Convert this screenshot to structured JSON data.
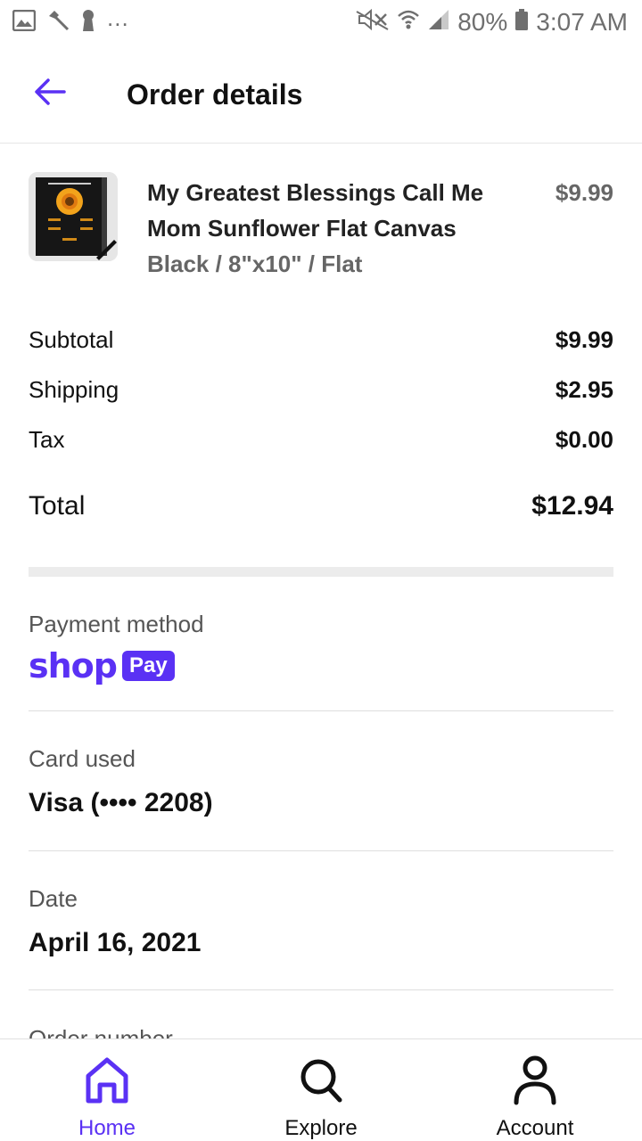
{
  "status_bar": {
    "ellipsis": "...",
    "battery": "80%",
    "time": "3:07 AM"
  },
  "header": {
    "title": "Order details"
  },
  "item": {
    "name": "My Greatest Blessings Call Me Mom Sunflower Flat Canvas",
    "variant": "Black / 8\"x10\" / Flat",
    "price": "$9.99"
  },
  "summary": {
    "subtotal_label": "Subtotal",
    "subtotal_value": "$9.99",
    "shipping_label": "Shipping",
    "shipping_value": "$2.95",
    "tax_label": "Tax",
    "tax_value": "$0.00",
    "total_label": "Total",
    "total_value": "$12.94"
  },
  "payment": {
    "label": "Payment method",
    "brand_shop": "shop",
    "brand_pay": "Pay"
  },
  "card": {
    "label": "Card used",
    "value": "Visa (•••• 2208)"
  },
  "date": {
    "label": "Date",
    "value": "April 16, 2021"
  },
  "order_number": {
    "label": "Order number"
  },
  "bottom_nav": {
    "home": "Home",
    "explore": "Explore",
    "account": "Account"
  },
  "colors": {
    "accent": "#5a31f4",
    "status_icons": "#6f6f6f"
  }
}
